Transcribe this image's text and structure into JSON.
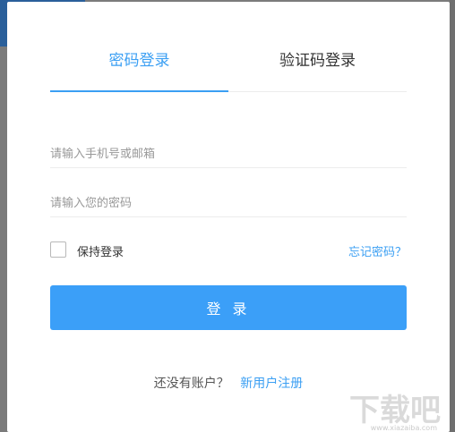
{
  "tabs": [
    {
      "label": "密码登录",
      "active": true
    },
    {
      "label": "验证码登录",
      "active": false
    }
  ],
  "form": {
    "phone_placeholder": "请输入手机号或邮箱",
    "password_placeholder": "请输入您的密码",
    "remember_label": "保持登录",
    "forgot_label": "忘记密码？",
    "login_label": "登 录"
  },
  "register": {
    "prompt": "还没有账户？",
    "link": "新用户注册"
  },
  "watermark": {
    "text": "下载吧",
    "sub": "www.xiazaiba.com"
  },
  "colors": {
    "accent": "#3b9ff3",
    "button": "#3b9ff8"
  }
}
